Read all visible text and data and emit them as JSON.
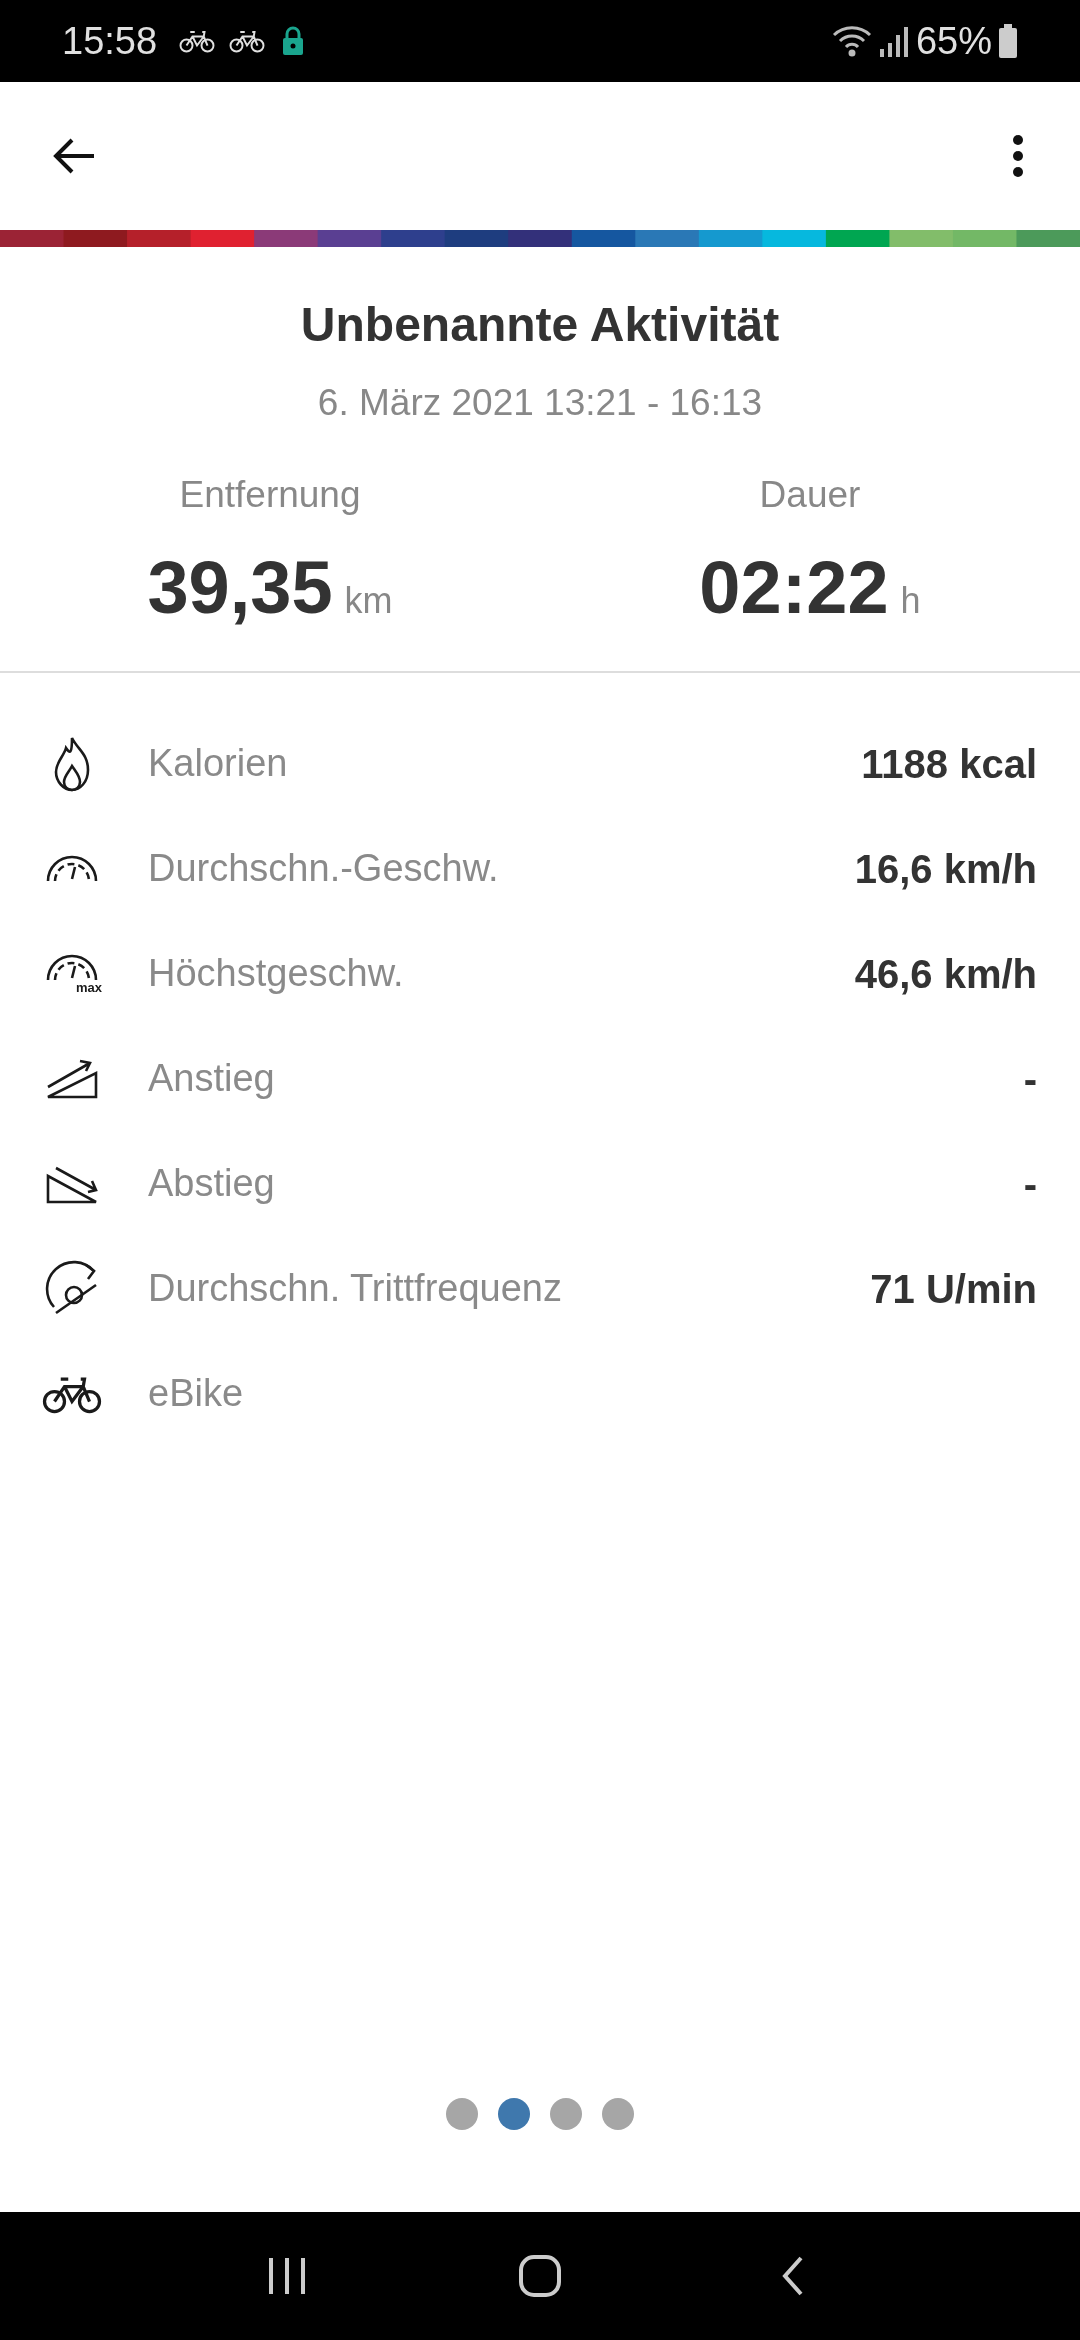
{
  "status_bar": {
    "time": "15:58",
    "battery": "65%"
  },
  "activity": {
    "title": "Unbenannte Aktivität",
    "date": "6. März 2021 13:21 - 16:13"
  },
  "summary": [
    {
      "label": "Entfernung",
      "value": "39,35",
      "unit": "km"
    },
    {
      "label": "Dauer",
      "value": "02:22",
      "unit": "h"
    }
  ],
  "stats": [
    {
      "kind": "calories",
      "label": "Kalorien",
      "value": "1188 kcal"
    },
    {
      "kind": "avg_speed",
      "label": "Durchschn.-Geschw.",
      "value": "16,6 km/h"
    },
    {
      "kind": "max_speed",
      "label": "Höchstgeschw.",
      "value": "46,6 km/h",
      "icon_label": "max"
    },
    {
      "kind": "ascent",
      "label": "Anstieg",
      "value": "-"
    },
    {
      "kind": "descent",
      "label": "Abstieg",
      "value": "-"
    },
    {
      "kind": "cadence",
      "label": "Durchschn. Trittfrequenz",
      "value": "71 U/min"
    },
    {
      "kind": "ebike",
      "label": "eBike"
    }
  ],
  "pages": [
    {
      "selected": false
    },
    {
      "selected": true
    },
    {
      "selected": false
    },
    {
      "selected": false
    }
  ]
}
